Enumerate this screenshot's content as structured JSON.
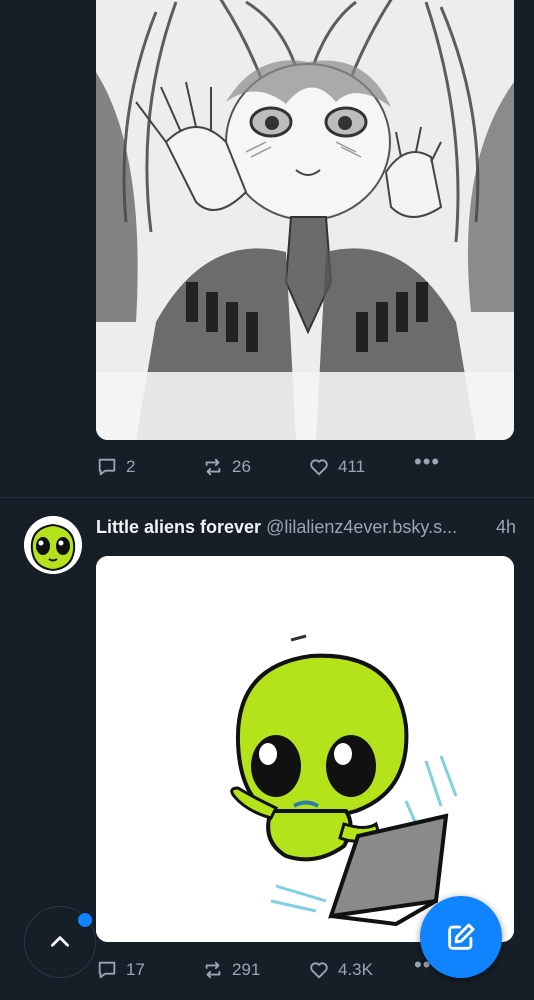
{
  "posts": [
    {
      "image_alt": "",
      "stats": {
        "replies": "2",
        "reposts": "26",
        "likes": "411"
      }
    },
    {
      "author": {
        "name": "Little aliens forever",
        "handle": "@lilalienz4ever.bsky.s..."
      },
      "time": "4h",
      "stats": {
        "replies": "17",
        "reposts": "291",
        "likes": "4.3K"
      }
    }
  ],
  "colors": {
    "background": "#161e27",
    "muted_text": "#9aa6b4",
    "accent": "#1083fe",
    "alien_green": "#b4e31c"
  },
  "icons": {
    "reply": "speech-bubble-icon",
    "repost": "repost-arrows-icon",
    "like": "heart-icon",
    "more": "ellipsis-icon",
    "scroll_top": "chevron-up-icon",
    "compose": "pencil-square-icon"
  }
}
